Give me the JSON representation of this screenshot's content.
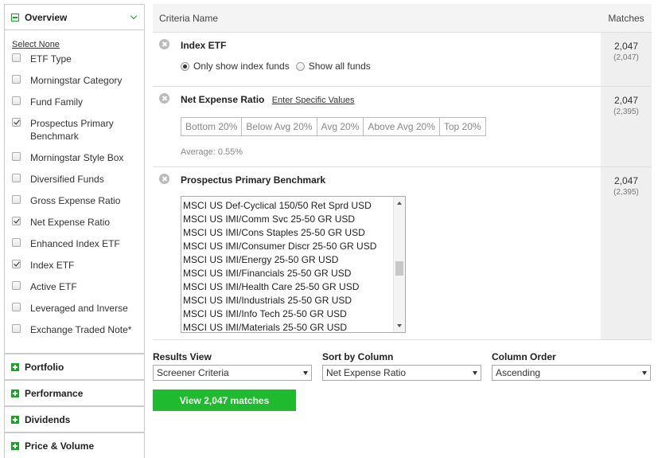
{
  "sidebar": {
    "overview": {
      "title": "Overview",
      "select_none": "Select None",
      "items": [
        {
          "label": "ETF Type",
          "checked": false
        },
        {
          "label": "Morningstar Category",
          "checked": false
        },
        {
          "label": "Fund Family",
          "checked": false
        },
        {
          "label": "Prospectus Primary Benchmark",
          "checked": true
        },
        {
          "label": "Morningstar Style Box",
          "checked": false
        },
        {
          "label": "Diversified Funds",
          "checked": false
        },
        {
          "label": "Gross Expense Ratio",
          "checked": false
        },
        {
          "label": "Net Expense Ratio",
          "checked": true
        },
        {
          "label": "Enhanced Index ETF",
          "checked": false
        },
        {
          "label": "Index ETF",
          "checked": true
        },
        {
          "label": "Active ETF",
          "checked": false
        },
        {
          "label": "Leveraged and Inverse",
          "checked": false
        },
        {
          "label": "Exchange Traded Note*",
          "checked": false
        }
      ]
    },
    "panels": [
      "Portfolio",
      "Performance",
      "Dividends",
      "Price & Volume"
    ]
  },
  "table": {
    "header_name": "Criteria Name",
    "header_matches": "Matches"
  },
  "criteria": {
    "index_etf": {
      "title": "Index ETF",
      "options": [
        "Only show index funds",
        "Show all funds"
      ],
      "selected": "Only show index funds",
      "matches": "2,047",
      "total": "(2,047)"
    },
    "net_expense": {
      "title": "Net Expense Ratio",
      "link": "Enter Specific Values",
      "buttons": [
        "Bottom 20%",
        "Below Avg 20%",
        "Avg 20%",
        "Above Avg 20%",
        "Top 20%"
      ],
      "average": "Average: 0.55%",
      "matches": "2,047",
      "total": "(2,395)"
    },
    "benchmark": {
      "title": "Prospectus Primary Benchmark",
      "options": [
        "MSCI US Def-Cyclical 150/50 Ret Sprd USD",
        "MSCI US IMI/Comm Svc 25-50 GR USD",
        "MSCI US IMI/Cons Staples 25-50 GR USD",
        "MSCI US IMI/Consumer Discr 25-50 GR USD",
        "MSCI US IMI/Energy 25-50 GR USD",
        "MSCI US IMI/Financials 25-50 GR USD",
        "MSCI US IMI/Health Care 25-50 GR USD",
        "MSCI US IMI/Industrials 25-50 GR USD",
        "MSCI US IMI/Info Tech 25-50 GR USD",
        "MSCI US IMI/Materials 25-50 GR USD"
      ],
      "matches": "2,047",
      "total": "(2,395)"
    }
  },
  "results": {
    "view_label": "Results View",
    "view_value": "Screener Criteria",
    "sort_label": "Sort by Column",
    "sort_value": "Net Expense Ratio",
    "order_label": "Column Order",
    "order_value": "Ascending",
    "button": "View 2,047 matches"
  },
  "colors": {
    "accent_green": "#1fba2e",
    "match_bg": "#efefef"
  }
}
